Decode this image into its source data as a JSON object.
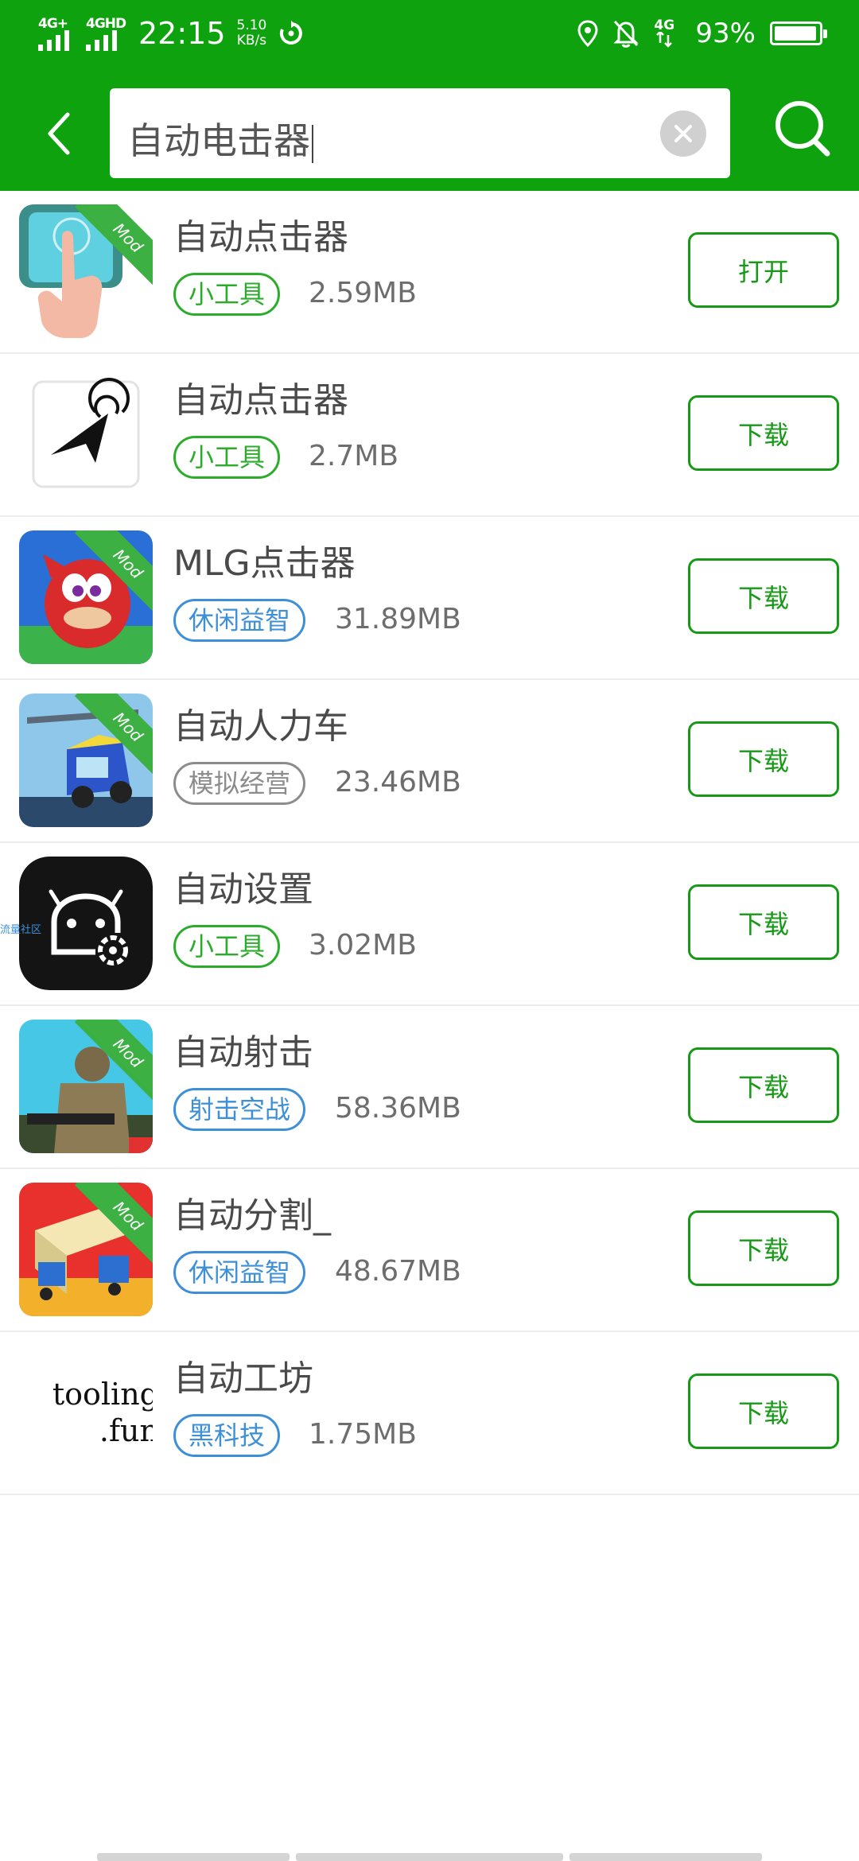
{
  "status_bar": {
    "sim1_label": "4G+",
    "sim2_label": "4GHD",
    "time": "22:15",
    "speed_value": "5.10",
    "speed_unit": "KB/s",
    "network_right": "4G",
    "battery": "93%",
    "battery_level": 0.93,
    "icons": [
      "signal-icon",
      "sync-icon",
      "location-icon",
      "bell-muted-icon",
      "network-icon",
      "battery-icon"
    ]
  },
  "search": {
    "query": "自动电击器",
    "icons": [
      "back-arrow-icon",
      "clear-icon",
      "search-icon"
    ]
  },
  "colors": {
    "brand_green": "#0ea30e",
    "button_green": "#179917",
    "tag_green": "#2bad2b",
    "tag_blue": "#3d8fd8",
    "tag_gray": "#8c8c8c"
  },
  "results": [
    {
      "name": "自动点击器",
      "tag": "小工具",
      "tag_color": "green",
      "size": "2.59MB",
      "action": "打开",
      "icon": "tap-finger-icon",
      "badge": "Mod"
    },
    {
      "name": "自动点击器",
      "tag": "小工具",
      "tag_color": "green",
      "size": "2.7MB",
      "action": "下载",
      "icon": "cursor-click-icon",
      "badge": ""
    },
    {
      "name": "MLG点击器",
      "tag": "休闲益智",
      "tag_color": "blue",
      "size": "31.89MB",
      "action": "下载",
      "icon": "knuckles-icon",
      "badge": "Mod"
    },
    {
      "name": "自动人力车",
      "tag": "模拟经营",
      "tag_color": "gray",
      "size": "23.46MB",
      "action": "下载",
      "icon": "rickshaw-icon",
      "badge": "Mod"
    },
    {
      "name": "自动设置",
      "tag": "小工具",
      "tag_color": "green",
      "size": "3.02MB",
      "action": "下载",
      "icon": "android-settings-icon",
      "badge": "",
      "watermark": "流量社区"
    },
    {
      "name": "自动射击",
      "tag": "射击空战",
      "tag_color": "blue",
      "size": "58.36MB",
      "action": "下载",
      "icon": "soldier-icon",
      "badge": "Mod"
    },
    {
      "name": "自动分割_",
      "tag": "休闲益智",
      "tag_color": "blue",
      "size": "48.67MB",
      "action": "下载",
      "icon": "trucks-icon",
      "badge": "Mod"
    },
    {
      "name": "自动工坊",
      "tag": "黑科技",
      "tag_color": "blue",
      "size": "1.75MB",
      "action": "下载",
      "icon": "tooling-fun-logo",
      "badge": "",
      "logo_text_1": "tooling",
      "logo_text_2": ".fun"
    }
  ]
}
